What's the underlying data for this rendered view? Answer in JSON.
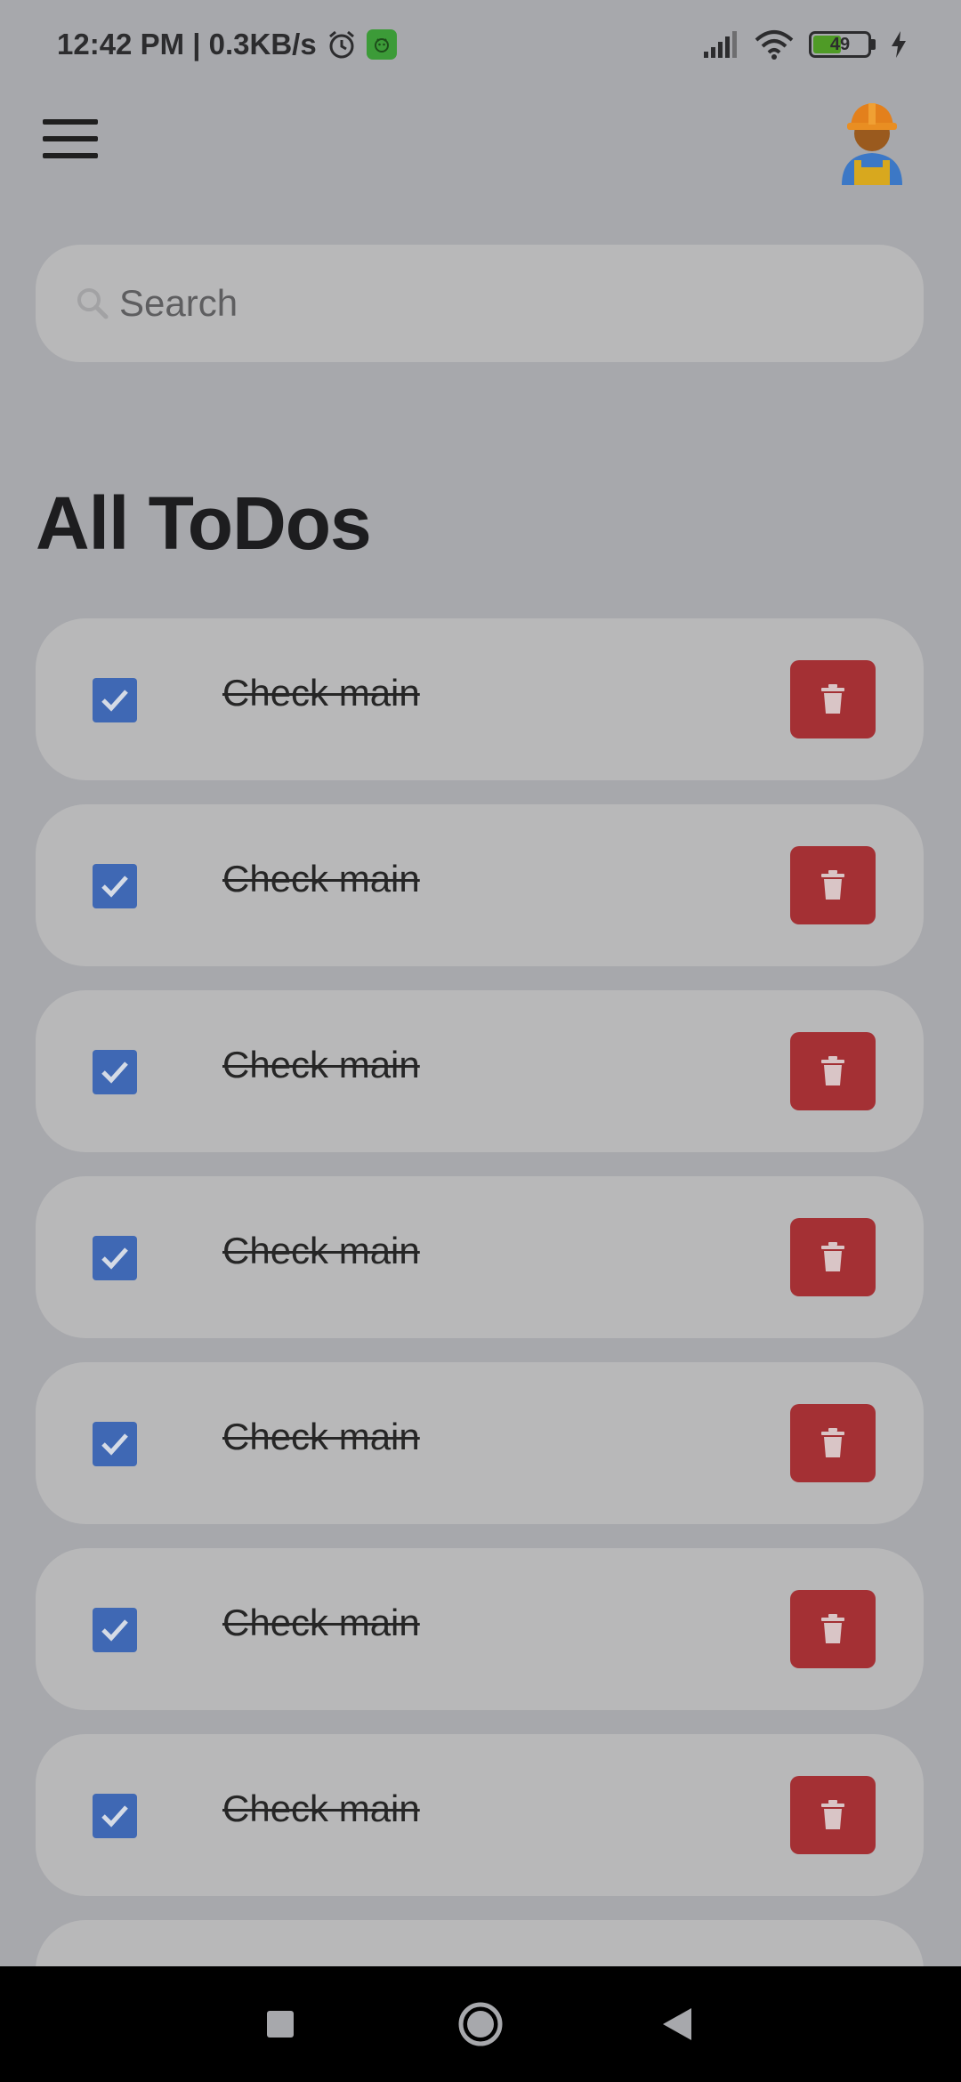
{
  "status_bar": {
    "time_speed": "12:42 PM | 0.3KB/s",
    "battery_level": "49",
    "battery_fraction": 0.49
  },
  "header": {
    "menu_icon": "hamburger-menu-icon",
    "avatar_icon": "construction-worker-emoji"
  },
  "search": {
    "placeholder": "Search",
    "value": ""
  },
  "main": {
    "title": "All ToDos",
    "todos": [
      {
        "text": "Check main",
        "done": true
      },
      {
        "text": "Check main",
        "done": true
      },
      {
        "text": "Check main",
        "done": true
      },
      {
        "text": "Check main",
        "done": true
      },
      {
        "text": "Check main",
        "done": true
      },
      {
        "text": "Check main",
        "done": true
      },
      {
        "text": "Check main",
        "done": true
      }
    ]
  },
  "colors": {
    "overlay_background": "#a7a8ac",
    "card_background": "#b8b8b9",
    "checkbox": "#3f68b4",
    "delete": "#a43034"
  },
  "navigation": {
    "buttons": [
      "recents-square-icon",
      "home-circle-icon",
      "back-triangle-icon"
    ]
  }
}
